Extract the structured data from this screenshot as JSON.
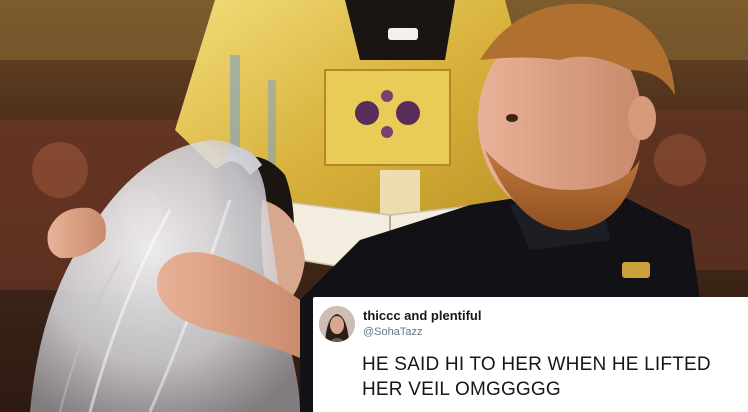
{
  "photo": {
    "description_icon": "wedding-photo"
  },
  "tweet": {
    "display_name": "thiccc and plentiful",
    "handle": "@SohaTazz",
    "text": "HE SAID HI TO HER WHEN HE LIFTED HER VEIL OMGGGGG"
  },
  "colors": {
    "background": "#3a2418",
    "vestment_gold": "#e6c34a",
    "uniform_black": "#111114",
    "card_bg": "#ffffff",
    "name_text": "#14171a",
    "handle_text": "#657786"
  }
}
